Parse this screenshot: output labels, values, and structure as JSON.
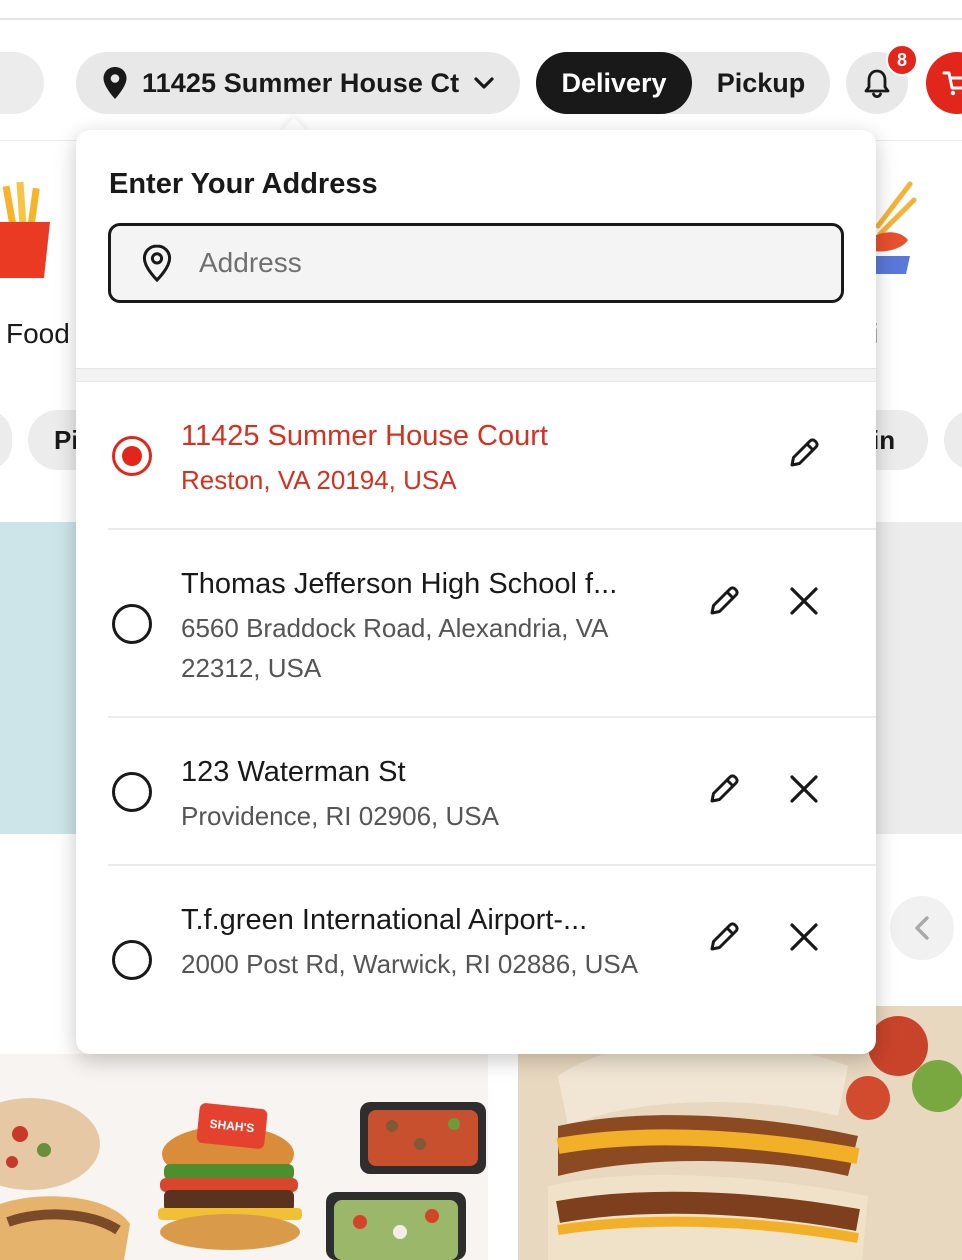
{
  "header": {
    "address_pill": "11425 Summer House Ct",
    "delivery_label": "Delivery",
    "pickup_label": "Pickup",
    "notification_count": "8"
  },
  "background": {
    "category_left": "Food",
    "category_right": "i",
    "chip_left": "Pi",
    "chip_right": "in",
    "photo_logo_text": "SHAH'S"
  },
  "address_popover": {
    "title": "Enter Your Address",
    "input_placeholder": "Address",
    "input_value": "",
    "saved_addresses": [
      {
        "name": "11425 Summer House Court",
        "subtitle": "Reston, VA 20194, USA",
        "selected": true
      },
      {
        "name": "Thomas Jefferson High School f...",
        "subtitle": "6560 Braddock Road, Alexandria, VA 22312, USA",
        "selected": false
      },
      {
        "name": "123 Waterman St",
        "subtitle": "Providence, RI 02906, USA",
        "selected": false
      },
      {
        "name": "T.f.green International Airport-...",
        "subtitle": "2000 Post Rd, Warwick, RI 02886, USA",
        "selected": false
      }
    ]
  },
  "icons": {
    "location": "map-pin-icon",
    "chevron": "chevron-down-icon",
    "bell": "bell-icon",
    "cart": "cart-icon",
    "edit": "pencil-icon",
    "delete": "close-icon",
    "carousel_prev": "chevron-left-icon"
  },
  "colors": {
    "brand_red": "#e3261b",
    "selected_text": "#d7301f",
    "dark": "#191919",
    "pill_grey": "#e8e8e8",
    "banner_teal": "#cde5e8"
  }
}
